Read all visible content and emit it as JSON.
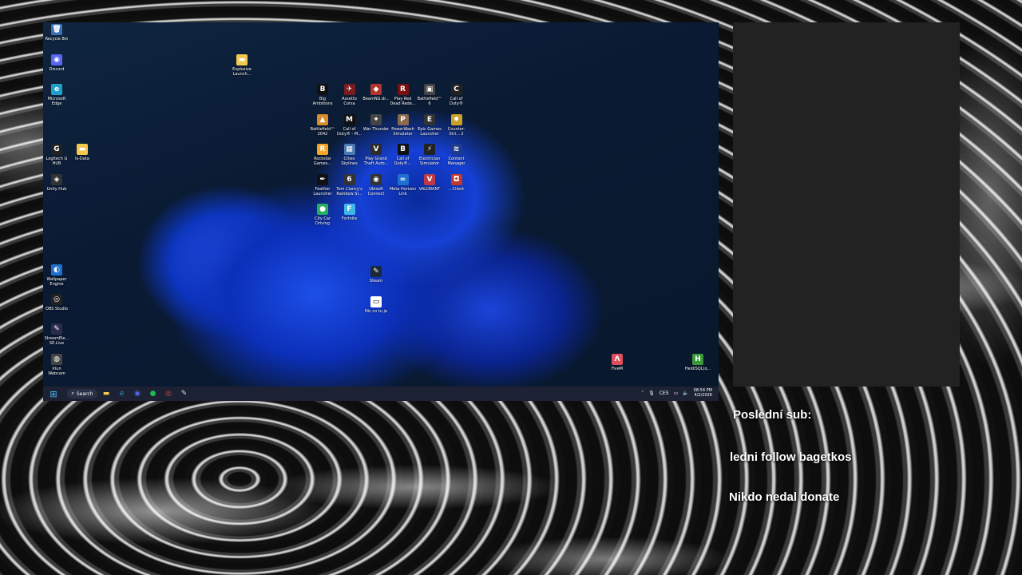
{
  "desktop": {
    "left_icons": [
      {
        "name": "recycle-bin",
        "label": "Recycle Bin",
        "glyph": "🗑",
        "color": "#3a6fb0"
      },
      {
        "name": "discord",
        "label": "Discord",
        "glyph": "◉",
        "color": "#5865f2"
      },
      {
        "name": "microsoft-edge",
        "label": "Microsoft Edge",
        "glyph": "e",
        "color": "#1fa0c8"
      },
      {
        "name": "logitech-g-hub",
        "label": "Logitech G HUB",
        "glyph": "G",
        "color": "#222"
      },
      {
        "name": "unity-hub",
        "label": "Unity Hub",
        "glyph": "◈",
        "color": "#333"
      },
      {
        "name": "wallpaper-engine",
        "label": "Wallpaper Engine",
        "glyph": "◐",
        "color": "#1f6fd1"
      },
      {
        "name": "obs-studio",
        "label": "OBS Studio",
        "glyph": "◎",
        "color": "#222"
      },
      {
        "name": "streamelements",
        "label": "StreamEle... SE.Live",
        "glyph": "✎",
        "color": "#2c2c4a"
      },
      {
        "name": "iriun-webcam",
        "label": "Iriun Webcam",
        "glyph": "◍",
        "color": "#444"
      }
    ],
    "folder_icons": [
      {
        "name": "ls-data-folder",
        "label": "ls-Data",
        "glyph": "▬",
        "color": "#f2c94c"
      },
      {
        "name": "explosive-launch-folder",
        "label": "Explosive Launch...",
        "glyph": "▬",
        "color": "#f2c94c"
      }
    ],
    "grid_icons": [
      {
        "name": "big-ambitions",
        "label": "Big Ambitions",
        "glyph": "B",
        "color": "#111"
      },
      {
        "name": "assetto-corsa",
        "label": "Assetto Corsa",
        "glyph": "✈",
        "color": "#7a1c1c"
      },
      {
        "name": "beamng-drive",
        "label": "BeamNG.dr...",
        "glyph": "◆",
        "color": "#b3342c"
      },
      {
        "name": "play-red-dead",
        "label": "Play Red Dead Rede...",
        "glyph": "R",
        "color": "#7a0f0f"
      },
      {
        "name": "battlefield-6",
        "label": "Battlefield™ 6",
        "glyph": "▣",
        "color": "#444"
      },
      {
        "name": "call-of-duty",
        "label": "Call of Duty®",
        "glyph": "C",
        "color": "#222"
      },
      {
        "name": "battlefield-2042",
        "label": "Battlefield™ 2042",
        "glyph": "▲",
        "color": "#d98c2b"
      },
      {
        "name": "call-of-duty-mw",
        "label": "Call of Duty® - M...",
        "glyph": "M",
        "color": "#111"
      },
      {
        "name": "war-thunder",
        "label": "War Thunder",
        "glyph": "✦",
        "color": "#444"
      },
      {
        "name": "powerwash-simulator",
        "label": "PowerWash Simulator",
        "glyph": "P",
        "color": "#8a6a4a"
      },
      {
        "name": "epic-games-launcher",
        "label": "Epic Games Launcher",
        "glyph": "E",
        "color": "#333"
      },
      {
        "name": "counter-strike-2",
        "label": "Counter-Stri... 2",
        "glyph": "✸",
        "color": "#c9a227"
      },
      {
        "name": "rockstar-games",
        "label": "Rockstar Games...",
        "glyph": "R",
        "color": "#f5a623"
      },
      {
        "name": "cities-skylines",
        "label": "Cities Skylines",
        "glyph": "▦",
        "color": "#4a7ab0"
      },
      {
        "name": "play-gta",
        "label": "Play Grand Theft Auto...",
        "glyph": "V",
        "color": "#2c2c2c"
      },
      {
        "name": "call-of-duty-black-ops",
        "label": "Call of Duty®...",
        "glyph": "B",
        "color": "#111"
      },
      {
        "name": "electrician-simulator",
        "label": "Electrician Simulator",
        "glyph": "⚡",
        "color": "#222"
      },
      {
        "name": "content-manager",
        "label": "Content Manager",
        "glyph": "≋",
        "color": "#1e3a8a"
      },
      {
        "name": "feather-launcher",
        "label": "Feather Launcher",
        "glyph": "✒",
        "color": "#111"
      },
      {
        "name": "rainbow-six",
        "label": "Tom Clancy's Rainbow Si...",
        "glyph": "6",
        "color": "#333"
      },
      {
        "name": "ubisoft-connect",
        "label": "Ubisoft Connect",
        "glyph": "◉",
        "color": "#333"
      },
      {
        "name": "meta-horizon-link",
        "label": "Meta Horizon Link",
        "glyph": "∞",
        "color": "#1f6fd1"
      },
      {
        "name": "valorant",
        "label": "VALORANT",
        "glyph": "V",
        "color": "#bd3944"
      },
      {
        "name": "epic-client",
        "label": "...Client",
        "glyph": "◘",
        "color": "#c0392b"
      },
      {
        "name": "city-car-driving",
        "label": "City Car Driving",
        "glyph": "●",
        "color": "#27ae60"
      },
      {
        "name": "fortnite",
        "label": "Fortnite",
        "glyph": "F",
        "color": "#3fb6e8"
      }
    ],
    "misc_icons": [
      {
        "name": "steam",
        "label": "Steam",
        "glyph": "✎",
        "color": "#1b2838"
      },
      {
        "name": "text-file",
        "label": "Nic co tu je",
        "glyph": "▭",
        "color": "#ffffff"
      },
      {
        "name": "fivem",
        "label": "FiveM",
        "glyph": "Λ",
        "color": "#e04e5c"
      },
      {
        "name": "heidisql",
        "label": "HeidiSQL(o...",
        "glyph": "H",
        "color": "#3a9a3a"
      }
    ]
  },
  "taskbar": {
    "search_label": "Search",
    "apps": [
      {
        "name": "file-explorer",
        "glyph": "▬",
        "color": "#f2c94c"
      },
      {
        "name": "edge",
        "glyph": "e",
        "color": "#1fa0c8"
      },
      {
        "name": "discord",
        "glyph": "◉",
        "color": "#5865f2"
      },
      {
        "name": "spotify",
        "glyph": "●",
        "color": "#1db954"
      },
      {
        "name": "obs",
        "glyph": "◎",
        "color": "#e74c3c"
      },
      {
        "name": "steam",
        "glyph": "✎",
        "color": "#cfd8e3"
      }
    ],
    "tray": {
      "language": "CES",
      "time": "08:54 PM",
      "date": "4/2/2026"
    }
  },
  "overlay": {
    "last_sub": "Poslední sub:",
    "last_follow": "ledni follow bagetkos",
    "donate": "Nikdo nedal donate"
  },
  "colors": {
    "panel_bg": "#222222",
    "taskbar_bg": "#1c2233"
  }
}
